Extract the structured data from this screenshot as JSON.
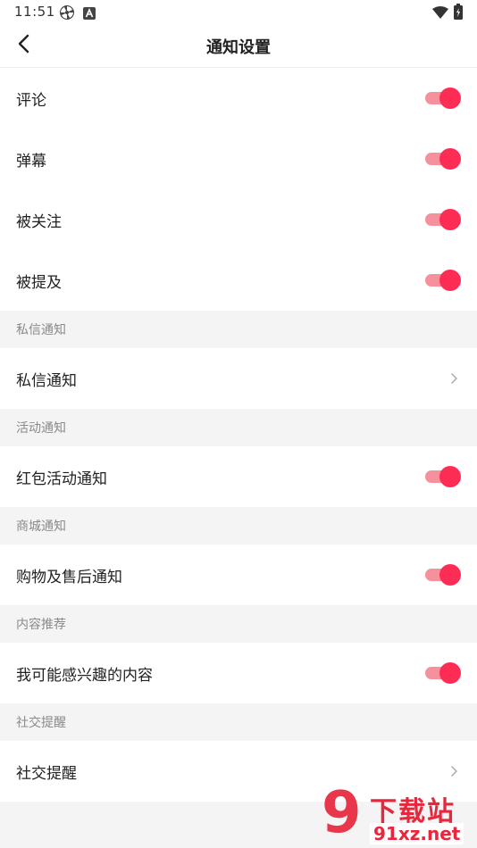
{
  "status_bar": {
    "time": "11:51",
    "icons": [
      "pinwheel-icon",
      "a-badge-icon",
      "wifi-icon",
      "battery-icon"
    ]
  },
  "header": {
    "back_icon": "back-arrow-icon",
    "title": "通知设置"
  },
  "rows_main": [
    {
      "label": "评论",
      "enabled": true
    },
    {
      "label": "弹幕",
      "enabled": true
    },
    {
      "label": "被关注",
      "enabled": true
    },
    {
      "label": "被提及",
      "enabled": true
    }
  ],
  "sections": [
    {
      "header": "私信通知",
      "row": {
        "label": "私信通知",
        "type": "link"
      }
    },
    {
      "header": "活动通知",
      "row": {
        "label": "红包活动通知",
        "type": "toggle",
        "enabled": true
      }
    },
    {
      "header": "商城通知",
      "row": {
        "label": "购物及售后通知",
        "type": "toggle",
        "enabled": true
      }
    },
    {
      "header": "内容推荐",
      "row": {
        "label": "我可能感兴趣的内容",
        "type": "toggle",
        "enabled": true
      }
    },
    {
      "header": "社交提醒",
      "row": {
        "label": "社交提醒",
        "type": "link"
      }
    }
  ],
  "watermark": {
    "logo_text": "9",
    "title": "下载站",
    "domain": "91xz.net"
  },
  "colors": {
    "accent": "#fd2c55",
    "accent_track": "#f5919c",
    "section_bg": "#f4f4f4",
    "section_text": "#8a8a8a",
    "watermark_red": "#e8263c"
  }
}
